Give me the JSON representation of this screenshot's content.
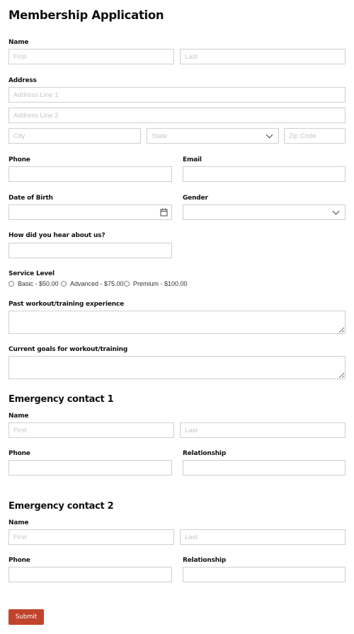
{
  "form": {
    "title": "Membership Application",
    "name": {
      "label": "Name",
      "first_placeholder": "First",
      "last_placeholder": "Last"
    },
    "address": {
      "label": "Address",
      "line1_placeholder": "Address Line 1",
      "line2_placeholder": "Address Line 2",
      "city_placeholder": "City",
      "state_placeholder": "State",
      "zip_placeholder": "Zip Code"
    },
    "phone": {
      "label": "Phone"
    },
    "email": {
      "label": "Email"
    },
    "dob": {
      "label": "Date of Birth"
    },
    "gender": {
      "label": "Gender"
    },
    "hear_about": {
      "label": "How did you hear about us?"
    },
    "service_level": {
      "label": "Service Level",
      "options": [
        "Basic - $50.00",
        "Advanced - $75.00",
        "Premium - $100.00"
      ]
    },
    "past_experience": {
      "label": "Past workout/training experience"
    },
    "current_goals": {
      "label": "Current goals for workout/training"
    },
    "emergency1": {
      "heading": "Emergency contact 1",
      "name_label": "Name",
      "first_placeholder": "First",
      "last_placeholder": "Last",
      "phone_label": "Phone",
      "relationship_label": "Relationship"
    },
    "emergency2": {
      "heading": "Emergency contact 2",
      "name_label": "Name",
      "first_placeholder": "First",
      "last_placeholder": "Last",
      "phone_label": "Phone",
      "relationship_label": "Relationship"
    },
    "submit_label": "Submit"
  },
  "colors": {
    "accent": "#c0432b",
    "border": "#cfcfcf",
    "placeholder": "#c6c6c6"
  },
  "icons": {
    "calendar": "calendar-icon",
    "dropdown": "chevron-down-icon"
  }
}
